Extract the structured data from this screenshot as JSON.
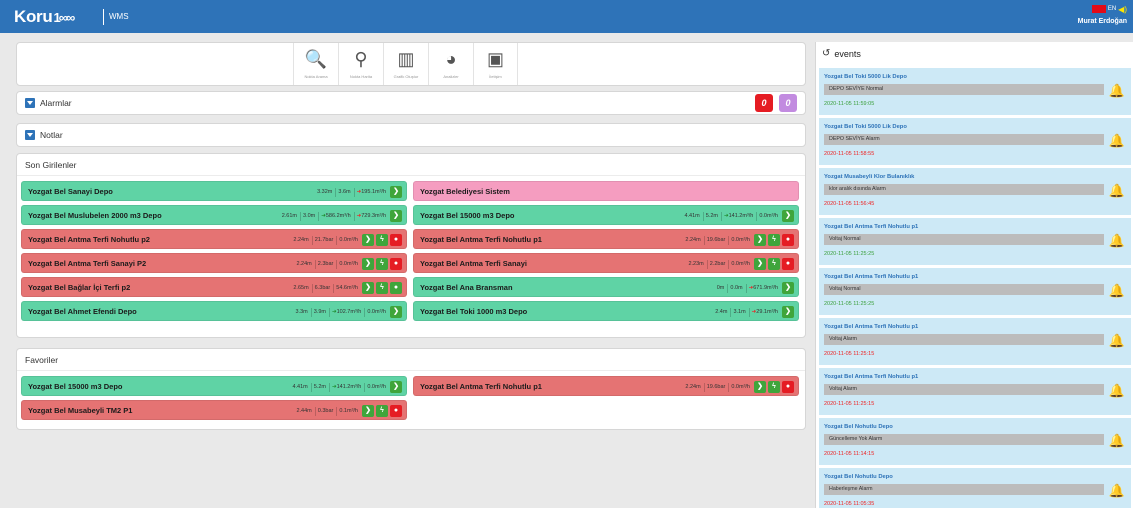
{
  "header": {
    "logo": "Koru",
    "logo_wave": "1∞∞",
    "product": "WMS",
    "lang": "EN",
    "user": "Murat Erdoğan"
  },
  "toolbar": [
    {
      "label": "Nokta Arama",
      "icon": "search-icon"
    },
    {
      "label": "Nokta Harita",
      "icon": "map-icon"
    },
    {
      "label": "Grafik Oluştur",
      "icon": "chart-icon"
    },
    {
      "label": "Analizler",
      "icon": "pie-chart-icon"
    },
    {
      "label": "İletişim",
      "icon": "contact-icon"
    }
  ],
  "sections": {
    "alarms": "Alarmlar",
    "notes": "Notlar",
    "recent": "Son Girilenler",
    "favorites": "Favoriler"
  },
  "recent_tiles": [
    {
      "name": "Yozgat Bel Sanayi Depo",
      "color": "green",
      "vals": [
        "3.32m",
        "3.6m"
      ],
      "out": "195.1m³/h",
      "icons": [
        "g"
      ]
    },
    {
      "name": "Yozgat Belediyesi Sistem",
      "color": "pink",
      "vals": [],
      "icons": []
    },
    {
      "name": "Yozgat Bel Muslubelen 2000 m3 Depo",
      "color": "green",
      "vals": [
        "2.61m",
        "3.0m"
      ],
      "in": "586.2m³/h",
      "out": "729.3m³/h",
      "icons": [
        "g"
      ]
    },
    {
      "name": "Yozgat Bel 15000 m3 Depo",
      "color": "green",
      "vals": [
        "4.41m",
        "5.2m"
      ],
      "in": "141.2m³/h",
      "tail": "0.0m³/h",
      "icons": [
        "g"
      ]
    },
    {
      "name": "Yozgat Bel Antma Terfi Nohutlu p2",
      "color": "red",
      "vals": [
        "2.24m",
        "21.7bar",
        "0.0m³/h"
      ],
      "icons": [
        "g",
        "g",
        "r"
      ]
    },
    {
      "name": "Yozgat Bel Antma Terfi Nohutlu p1",
      "color": "red",
      "vals": [
        "2.24m",
        "19.6bar",
        "0.0m³/h"
      ],
      "icons": [
        "g",
        "g",
        "r"
      ]
    },
    {
      "name": "Yozgat Bel Antma Terfi Sanayi P2",
      "color": "red",
      "vals": [
        "2.24m",
        "2.3bar",
        "0.0m³/h"
      ],
      "icons": [
        "g",
        "g",
        "r"
      ]
    },
    {
      "name": "Yozgat Bel Antma Terfi Sanayi",
      "color": "red",
      "vals": [
        "2.23m",
        "2.2bar",
        "0.0m³/h"
      ],
      "icons": [
        "g",
        "g",
        "r"
      ]
    },
    {
      "name": "Yozgat Bel Bağlar İçi Terfi p2",
      "color": "red",
      "vals": [
        "2.65m",
        "6.3bar",
        "54.6m³/h"
      ],
      "icons": [
        "g",
        "g",
        "g"
      ]
    },
    {
      "name": "Yozgat Bel Ana Bransman",
      "color": "green",
      "vals": [
        "0m",
        "0.0m"
      ],
      "out": "671.9m³/h",
      "icons": [
        "g"
      ]
    },
    {
      "name": "Yozgat Bel Ahmet Efendi Depo",
      "color": "green",
      "vals": [
        "3.3m",
        "3.9m"
      ],
      "in": "102.7m³/h",
      "tail": "0.0m³/h",
      "icons": [
        "g"
      ]
    },
    {
      "name": "Yozgat Bel Toki 1000 m3 Depo",
      "color": "green",
      "vals": [
        "2.4m",
        "3.1m"
      ],
      "out": "29.1m³/h",
      "icons": [
        "g"
      ]
    }
  ],
  "favorite_tiles": [
    {
      "name": "Yozgat Bel 15000 m3 Depo",
      "color": "green",
      "vals": [
        "4.41m",
        "5.2m"
      ],
      "in": "141.2m³/h",
      "tail": "0.0m³/h",
      "icons": [
        "g"
      ]
    },
    {
      "name": "Yozgat Bel Antma Terfi Nohutlu p1",
      "color": "red",
      "vals": [
        "2.24m",
        "19.6bar",
        "0.0m³/h"
      ],
      "icons": [
        "g",
        "g",
        "r"
      ]
    },
    {
      "name": "Yozgat Bel Musabeyli TM2 P1",
      "color": "red",
      "vals": [
        "2.44m",
        "0.3bar",
        "0.1m³/h"
      ],
      "icons": [
        "g",
        "g",
        "r"
      ]
    }
  ],
  "events_title": "events",
  "events": [
    {
      "title": "Yozgat Bel Toki 5000 Lik Depo",
      "msg": "DEPO SEVİYE Normal",
      "date": "2020-11-05 11:59:05",
      "status": "normal"
    },
    {
      "title": "Yozgat Bel Toki 5000 Lik Depo",
      "msg": "DEPO SEVİYE Alarm",
      "date": "2020-11-05 11:58:55",
      "status": "alarm"
    },
    {
      "title": "Yozgat Musabeyli Klor Bulanıklık",
      "msg": "klor aralık dısında Alarm",
      "date": "2020-11-05 11:56:45",
      "status": "alarm"
    },
    {
      "title": "Yozgat Bel Antma Terfi Nohutlu p1",
      "msg": "Voltaj Normal",
      "date": "2020-11-05 11:25:25",
      "status": "normal"
    },
    {
      "title": "Yozgat Bel Antma Terfi Nohutlu p1",
      "msg": "Voltaj Normal",
      "date": "2020-11-05 11:25:25",
      "status": "normal"
    },
    {
      "title": "Yozgat Bel Antma Terfi Nohutlu p1",
      "msg": "Voltaj Alarm",
      "date": "2020-11-05 11:25:15",
      "status": "alarm"
    },
    {
      "title": "Yozgat Bel Antma Terfi Nohutlu p1",
      "msg": "Voltaj Alarm",
      "date": "2020-11-05 11:25:15",
      "status": "alarm"
    },
    {
      "title": "Yozgat Bel Nohutlu Depo",
      "msg": "Güncelleme Yok Alarm",
      "date": "2020-11-05 11:14:15",
      "status": "alarm"
    },
    {
      "title": "Yozgat Bel Nohutlu Depo",
      "msg": "Haberleşme Alarm",
      "date": "2020-11-05 11:05:35",
      "status": "alarm"
    }
  ]
}
